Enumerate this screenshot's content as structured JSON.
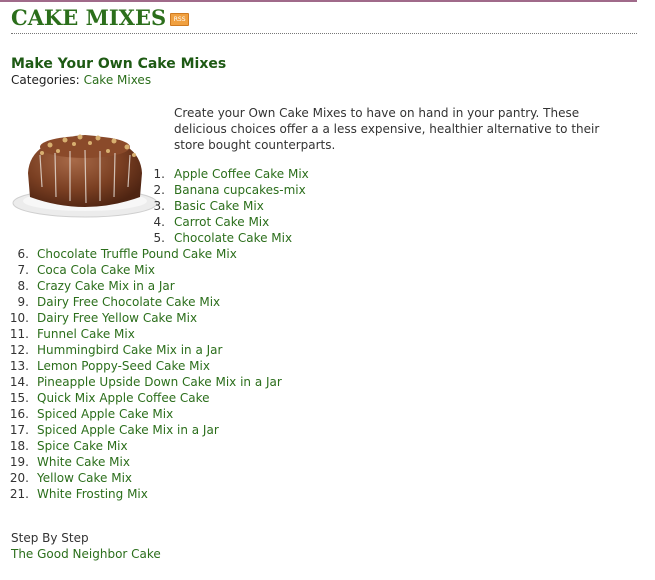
{
  "header": {
    "title": "CAKE MIXES",
    "rss_label": "RSS"
  },
  "post": {
    "title": "Make Your Own Cake Mixes",
    "categories_label": "Categories:",
    "category": "Cake Mixes",
    "intro": "Create your Own Cake Mixes to have on hand in your pantry. These delicious choices offer a a less expensive, healthier alternative to their store bought counterparts."
  },
  "recipes": [
    {
      "num": "1.",
      "label": "Apple Coffee Cake Mix"
    },
    {
      "num": "2.",
      "label": "Banana cupcakes-mix"
    },
    {
      "num": "3.",
      "label": "Basic Cake Mix"
    },
    {
      "num": "4.",
      "label": "Carrot Cake Mix"
    },
    {
      "num": "5.",
      "label": "Chocolate Cake Mix"
    },
    {
      "num": "6.",
      "label": "Chocolate Truffle Pound Cake Mix"
    },
    {
      "num": "7.",
      "label": "Coca Cola Cake Mix"
    },
    {
      "num": "8.",
      "label": "Crazy Cake Mix in a Jar"
    },
    {
      "num": "9.",
      "label": "Dairy Free Chocolate Cake Mix"
    },
    {
      "num": "10.",
      "label": "Dairy Free Yellow Cake Mix"
    },
    {
      "num": "11.",
      "label": "Funnel Cake Mix"
    },
    {
      "num": "12.",
      "label": "Hummingbird Cake Mix in a Jar"
    },
    {
      "num": "13.",
      "label": "Lemon Poppy-Seed Cake Mix"
    },
    {
      "num": "14.",
      "label": "Pineapple Upside Down Cake Mix in a Jar"
    },
    {
      "num": "15.",
      "label": "Quick Mix Apple Coffee Cake"
    },
    {
      "num": "16.",
      "label": "Spiced Apple Cake Mix"
    },
    {
      "num": "17.",
      "label": "Spiced Apple Cake Mix in a Jar"
    },
    {
      "num": "18.",
      "label": "Spice Cake Mix"
    },
    {
      "num": "19.",
      "label": "White Cake Mix"
    },
    {
      "num": "20.",
      "label": "Yellow Cake Mix"
    },
    {
      "num": "21.",
      "label": "White Frosting Mix"
    }
  ],
  "footer": {
    "section_label": "Step By Step",
    "next_link": "The Good Neighbor Cake"
  },
  "colors": {
    "link": "#2b6e1b",
    "title": "#1e5a14",
    "accent_line": "#a06a8a"
  }
}
